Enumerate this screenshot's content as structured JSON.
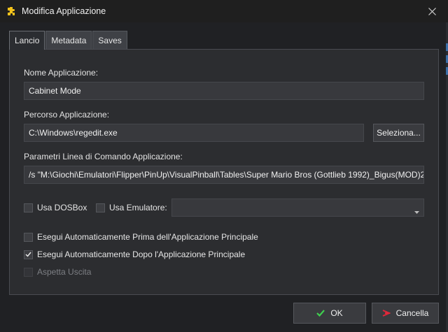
{
  "window": {
    "title": "Modifica Applicazione"
  },
  "tabs": [
    {
      "label": "Lancio",
      "active": true
    },
    {
      "label": "Metadata",
      "active": false
    },
    {
      "label": "Saves",
      "active": false
    }
  ],
  "form": {
    "name_label": "Nome Applicazione:",
    "name_value": "Cabinet Mode",
    "path_label": "Percorso Applicazione:",
    "path_value": "C:\\Windows\\regedit.exe",
    "browse_label": "Seleziona...",
    "params_label": "Parametri Linea di Comando Applicazione:",
    "params_value": "/s \"M:\\Giochi\\Emulatori\\Flipper\\PinUp\\VisualPinball\\Tables\\Super Mario Bros (Gottlieb 1992)_Bigus(MOD)2",
    "dosbox_label": "Usa DOSBox",
    "emulator_label": "Usa Emulatore:",
    "emulator_value": "",
    "run_before_label": "Esegui Automaticamente Prima dell'Applicazione Principale",
    "run_after_label": "Esegui Automaticamente Dopo l'Applicazione Principale",
    "wait_exit_label": "Aspetta Uscita"
  },
  "checks": {
    "dosbox": false,
    "emulator": false,
    "run_before": false,
    "run_after": true,
    "wait_exit": false
  },
  "footer": {
    "ok_label": "OK",
    "cancel_label": "Cancella"
  },
  "colors": {
    "ok_icon": "#3fcf4f",
    "cancel_icon": "#e0283a",
    "app_icon": "#f2c21b"
  },
  "icons": {
    "app": "puzzle-icon",
    "close": "close-icon",
    "ok": "checkmark-icon",
    "cancel": "cancel-icon",
    "dropdown": "chevron-down-icon"
  }
}
